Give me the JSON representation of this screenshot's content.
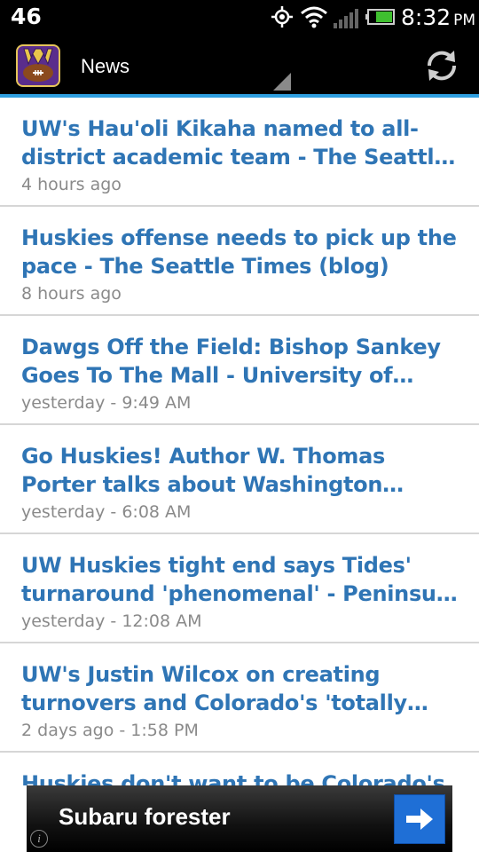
{
  "status_bar": {
    "left_number": "46",
    "time": "8:32",
    "ampm": "PM",
    "icons": [
      "gps-icon",
      "wifi-icon",
      "signal-icon",
      "battery-icon"
    ]
  },
  "action_bar": {
    "app_icon": "uw-huskies-logo",
    "title": "News",
    "refresh_icon": "refresh-icon"
  },
  "news": [
    {
      "title": "UW's Hau'oli Kikaha named to all-district academic team - The Seattle Times",
      "time": "4 hours ago"
    },
    {
      "title": "Huskies offense needs to pick up the pace - The Seattle Times (blog)",
      "time": "8 hours ago"
    },
    {
      "title": "Dawgs Off the Field: Bishop Sankey Goes To The Mall - University of Washington",
      "time": "yesterday - 9:49 AM"
    },
    {
      "title": "Go Huskies! Author W. Thomas Porter talks about Washington football and Dawgs",
      "time": "yesterday - 6:08 AM"
    },
    {
      "title": "UW Huskies tight end says Tides' turnaround 'phenomenal' - Peninsula Daily News",
      "time": "yesterday - 12:08 AM"
    },
    {
      "title": "UW's Justin Wilcox on creating turnovers and Colorado's 'totally different' offense",
      "time": "2 days ago - 1:58 PM"
    },
    {
      "title": "Huskies don't want to be Colorado's first",
      "time": ""
    }
  ],
  "ad": {
    "text": "Subaru forester",
    "info_label": "i",
    "colors": {
      "arrow_bg": "#1f6fd6"
    }
  },
  "colors": {
    "accent": "#2f9fe0",
    "headline": "#2f75b5",
    "timestamp": "#8a8a8a"
  }
}
